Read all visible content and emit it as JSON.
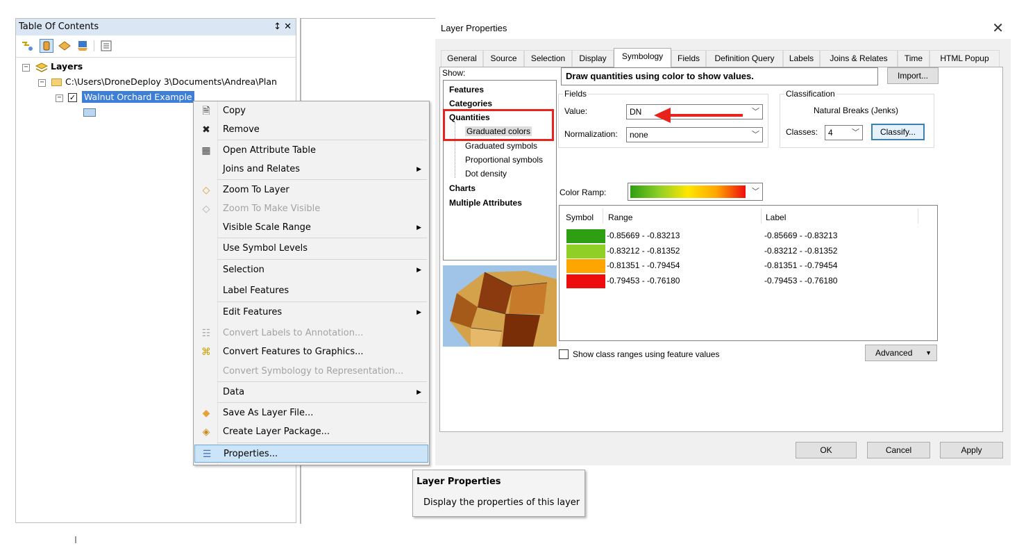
{
  "toc": {
    "title": "Table Of Contents",
    "pins": "↕ ✕",
    "layers_label": "Layers",
    "path_label": "C:\\Users\\DroneDeploy 3\\Documents\\Andrea\\Plan",
    "layer_name": "Walnut Orchard Example"
  },
  "context_menu": {
    "items": [
      {
        "label": "Copy",
        "icon": "copy-icon",
        "enabled": true
      },
      {
        "label": "Remove",
        "icon": "remove-icon",
        "enabled": true
      },
      {
        "label": "Open Attribute Table",
        "icon": "table-icon",
        "enabled": true
      },
      {
        "label": "Joins and Relates",
        "icon": "",
        "enabled": true,
        "submenu": true
      },
      {
        "label": "Zoom To Layer",
        "icon": "zoom-layer-icon",
        "enabled": true
      },
      {
        "label": "Zoom To Make Visible",
        "icon": "zoom-visible-icon",
        "enabled": false
      },
      {
        "label": "Visible Scale Range",
        "icon": "",
        "enabled": true,
        "submenu": true
      },
      {
        "label": "Use Symbol Levels",
        "icon": "",
        "enabled": true
      },
      {
        "label": "Selection",
        "icon": "",
        "enabled": true,
        "submenu": true
      },
      {
        "label": "Label Features",
        "icon": "",
        "enabled": true
      },
      {
        "label": "Edit Features",
        "icon": "",
        "enabled": true,
        "submenu": true
      },
      {
        "label": "Convert Labels to Annotation...",
        "icon": "annotation-icon",
        "enabled": false
      },
      {
        "label": "Convert Features to Graphics...",
        "icon": "graphics-icon",
        "enabled": true
      },
      {
        "label": "Convert Symbology to Representation...",
        "icon": "",
        "enabled": false
      },
      {
        "label": "Data",
        "icon": "",
        "enabled": true,
        "submenu": true
      },
      {
        "label": "Save As Layer File...",
        "icon": "layer-file-icon",
        "enabled": true
      },
      {
        "label": "Create Layer Package...",
        "icon": "package-icon",
        "enabled": true
      },
      {
        "label": "Properties...",
        "icon": "properties-icon",
        "enabled": true,
        "highlighted": true
      }
    ]
  },
  "tooltip": {
    "title": "Layer Properties",
    "text": "Display the properties of this layer"
  },
  "dialog": {
    "title": "Layer Properties",
    "close": "✕",
    "tabs": [
      "General",
      "Source",
      "Selection",
      "Display",
      "Symbology",
      "Fields",
      "Definition Query",
      "Labels",
      "Joins & Relates",
      "Time",
      "HTML Popup"
    ],
    "selected_tab": "Symbology",
    "show_label": "Show:",
    "show_items": {
      "features": "Features",
      "categories": "Categories",
      "quantities": "Quantities",
      "graduated_colors": "Graduated colors",
      "graduated_symbols": "Graduated symbols",
      "proportional_symbols": "Proportional symbols",
      "dot_density": "Dot density",
      "charts": "Charts",
      "multiple_attributes": "Multiple Attributes"
    },
    "heading": "Draw quantities using color to show values.",
    "import_button": "Import...",
    "fields_group": "Fields",
    "value_label": "Value:",
    "value": "DN",
    "normalization_label": "Normalization:",
    "normalization": "none",
    "classification_group": "Classification",
    "classification_method": "Natural Breaks (Jenks)",
    "classes_label": "Classes:",
    "classes_value": "4",
    "classify_button": "Classify...",
    "color_ramp_label": "Color Ramp:",
    "columns": {
      "symbol": "Symbol",
      "range": "Range",
      "label": "Label"
    },
    "classes": [
      {
        "color": "#2e9e12",
        "range": "-0.85669 - -0.83213",
        "label": "-0.85669 - -0.83213"
      },
      {
        "color": "#8fcf26",
        "range": "-0.83212 - -0.81352",
        "label": "-0.83212 - -0.81352"
      },
      {
        "color": "#ffa500",
        "range": "-0.81351 - -0.79454",
        "label": "-0.81351 - -0.79454"
      },
      {
        "color": "#ee0d0d",
        "range": "-0.79453 - -0.76180",
        "label": "-0.79453 - -0.76180"
      }
    ],
    "show_class_ranges": "Show class ranges using feature values",
    "advanced_button": "Advanced",
    "ok_button": "OK",
    "cancel_button": "Cancel",
    "apply_button": "Apply",
    "accent_red": "#e8231b"
  }
}
